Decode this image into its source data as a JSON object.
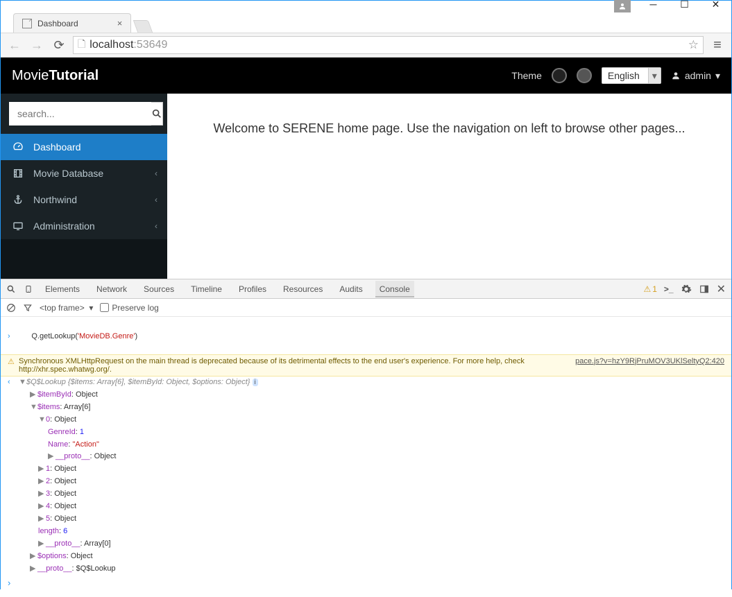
{
  "window": {
    "tab_title": "Dashboard",
    "url_host": "localhost",
    "url_port": ":53649"
  },
  "header": {
    "brand_light": "Movie",
    "brand_bold": "Tutorial",
    "theme_label": "Theme",
    "swatches": [
      "#222222",
      "#555555"
    ],
    "language": "English",
    "user": "admin"
  },
  "sidebar": {
    "search_placeholder": "search...",
    "items": [
      {
        "icon": "speedometer",
        "label": "Dashboard",
        "active": true,
        "expandable": false
      },
      {
        "icon": "film",
        "label": "Movie Database",
        "active": false,
        "expandable": true
      },
      {
        "icon": "anchor",
        "label": "Northwind",
        "active": false,
        "expandable": true
      },
      {
        "icon": "monitor",
        "label": "Administration",
        "active": false,
        "expandable": true
      }
    ]
  },
  "content": {
    "welcome": "Welcome to SERENE home page. Use the navigation on left to browse other pages..."
  },
  "devtools": {
    "tabs": [
      "Elements",
      "Network",
      "Sources",
      "Timeline",
      "Profiles",
      "Resources",
      "Audits",
      "Console"
    ],
    "active_tab": "Console",
    "warning_count": "1",
    "frame_selector": "<top frame>",
    "preserve_log_label": "Preserve log",
    "input_line": "Q.getLookup('MovieDB.Genre')",
    "input_str_part": "'MovieDB.Genre'",
    "warning_text": "Synchronous XMLHttpRequest on the main thread is deprecated because of its detrimental effects to the end user's experience. For more help, check http://xhr.spec.whatwg.org/.",
    "warning_source": "pace.js?v=hzY9RjPruMOV3UKlSeltyQ2:420",
    "lookup": {
      "root": "$Q$Lookup {$items: Array[6], $itemById: Object, $options: Object}",
      "itemById": "$itemById: Object",
      "items_label": "$items: Array[6]",
      "item0": "0: Object",
      "item0_genre_key": "GenreId",
      "item0_genre_val": "1",
      "item0_name_key": "Name",
      "item0_name_val": "\"Action\"",
      "item0_proto": "__proto__: Object",
      "item1": "1: Object",
      "item2": "2: Object",
      "item3": "3: Object",
      "item4": "4: Object",
      "item5": "5: Object",
      "length_key": "length",
      "length_val": "6",
      "items_proto": "__proto__: Array[0]",
      "options": "$options: Object",
      "root_proto": "__proto__: $Q$Lookup"
    }
  }
}
